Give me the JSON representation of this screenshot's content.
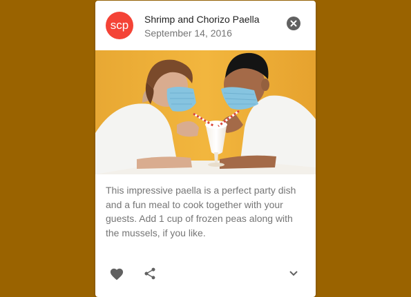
{
  "card": {
    "avatar_text": "scp",
    "title": "Shrimp and Chorizo Paella",
    "subheader": "September 14, 2016",
    "media_alt": "Photo of two people wearing face masks sharing a milkshake with straws",
    "description": "This impressive paella is a perfect party dish and a fun meal to cook together with your guests. Add 1 cup of frozen peas along with the mussels, if you like."
  },
  "icons": {
    "close": "close-icon",
    "favorite": "heart-icon",
    "share": "share-icon",
    "expand": "chevron-down-icon"
  },
  "colors": {
    "page_background": "#9a6300",
    "card_background": "#ffffff",
    "avatar_background": "#f44336",
    "icon": "#616161",
    "body_text": "#757575"
  }
}
